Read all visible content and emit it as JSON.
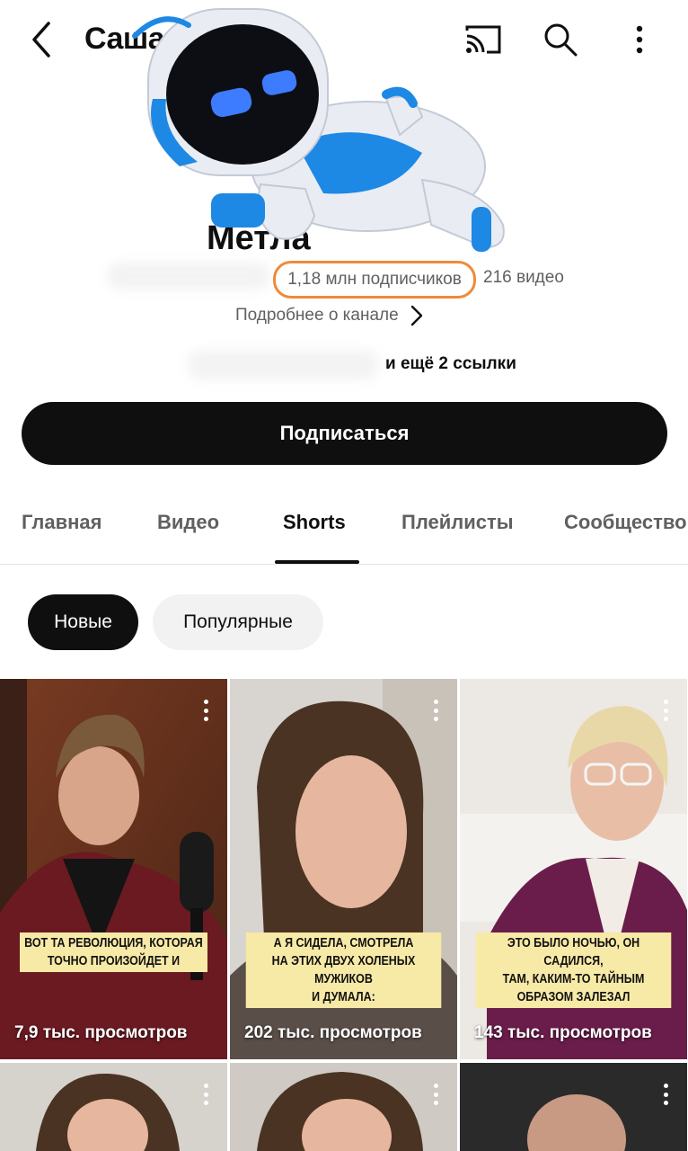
{
  "topbar": {
    "channel_title": "Саша Метла",
    "icons": [
      "back-icon",
      "cast-icon",
      "search-icon",
      "more-vertical-icon"
    ]
  },
  "channel": {
    "name": "Метла",
    "subscribers": "1,18 млн подписчиков",
    "videos": "216 видео",
    "more_about": "Подробнее о канале",
    "links": "и ещё 2 ссылки",
    "subscribe_label": "Подписаться"
  },
  "tabs": [
    {
      "label": "Главная",
      "active": false
    },
    {
      "label": "Видео",
      "active": false
    },
    {
      "label": "Shorts",
      "active": true
    },
    {
      "label": "Плейлисты",
      "active": false
    },
    {
      "label": "Сообщество",
      "active": false
    }
  ],
  "filters": [
    {
      "label": "Новые",
      "selected": true
    },
    {
      "label": "Популярные",
      "selected": false
    }
  ],
  "shorts": [
    {
      "caption": "ВОТ ТА РЕВОЛЮЦИЯ, КОТОРАЯ\nТОЧНО ПРОИЗОЙДЕТ И",
      "views": "7,9 тыс. просмотров"
    },
    {
      "caption": "А Я СИДЕЛА, СМОТРЕЛА\nНА ЭТИХ ДВУХ ХОЛЕНЫХ МУЖИКОВ\nИ ДУМАЛА:",
      "views": "202 тыс. просмотров"
    },
    {
      "caption": "ЭТО БЫЛО НОЧЬЮ, ОН САДИЛСЯ,\nТАМ, КАКИМ-ТО ТАЙНЫМ\nОБРАЗОМ ЗАЛЕЗАЛ",
      "views": "143 тыс. просмотров"
    }
  ],
  "colors": {
    "highlight_ring": "#ef8a3a",
    "caption_bg": "#f7e9a6",
    "robot_blue": "#1e88e5",
    "robot_visor_glow": "#3d7bff"
  }
}
